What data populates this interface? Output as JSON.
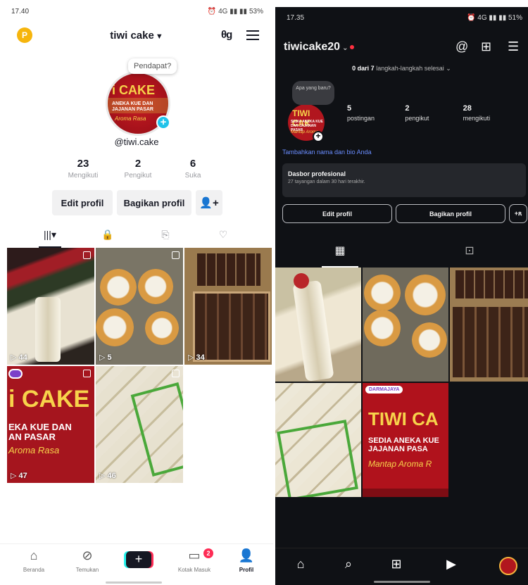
{
  "tiktok": {
    "status_time": "17.40",
    "status_icons": "⏰ 4G ▮▮ ▮▮",
    "battery": "53%",
    "coin": "P",
    "username": "tiwi cake",
    "header_icon_text": "θg",
    "note_bubble": "Pendapat?",
    "avatar_title": "i CAKE",
    "avatar_sub": "ANEKA KUE DAN JAJANAN PASAR",
    "avatar_script": "Aroma Rasa",
    "handle": "@tiwi.cake",
    "stats": [
      {
        "value": "23",
        "label": "Mengikuti"
      },
      {
        "value": "2",
        "label": "Pengikut"
      },
      {
        "value": "6",
        "label": "Suka"
      }
    ],
    "edit_label": "Edit profil",
    "share_label": "Bagikan profil",
    "add_friend_icon": "👤+",
    "videos": [
      {
        "views": "44"
      },
      {
        "views": "5"
      },
      {
        "views": "34"
      },
      {
        "views": "47",
        "title": "i CAKE",
        "sub": "EKA KUE DAN\nAN PASAR",
        "script": "Aroma Rasa"
      },
      {
        "views": "46"
      }
    ],
    "nav": [
      {
        "label": "Beranda",
        "icon": "⌂"
      },
      {
        "label": "Temukan",
        "icon": "⊘"
      },
      {
        "label": "Kotak Masuk",
        "icon": "▭",
        "badge": "2"
      },
      {
        "label": "Profil",
        "icon": "👤"
      }
    ],
    "create_icon": "+"
  },
  "instagram": {
    "status_time": "17.35",
    "status_icons": "⏰ 4G ▮▮ ▮▮",
    "battery": "51%",
    "username": "tiwicake20",
    "progress_bold": "0 dari 7",
    "progress_rest": " langkah-langkah selesai ⌄",
    "note": "Apa yang baru?",
    "avatar_title": "TIWI CAK",
    "avatar_sub": "SEDIA ANEKA KUE DAN JAJANAN PASAR",
    "avatar_script": "Mantap Aroma",
    "stats": [
      {
        "value": "5",
        "label": "postingan"
      },
      {
        "value": "2",
        "label": "pengikut"
      },
      {
        "value": "28",
        "label": "mengikuti"
      }
    ],
    "bio_link": "Tambahkan nama dan bio Anda",
    "dash_title": "Dasbor profesional",
    "dash_sub": "27 tayangan dalam 30 hari terakhir.",
    "edit_label": "Edit profil",
    "share_label": "Bagikan profil",
    "add_icon": "+ጸ",
    "post5_tag": "DARMAJAYA",
    "post5_title": "TIWI CA",
    "post5_sub": "SEDIA ANEKA KUE\nJAJANAN PASA",
    "post5_script": "Mantap Aroma R"
  }
}
